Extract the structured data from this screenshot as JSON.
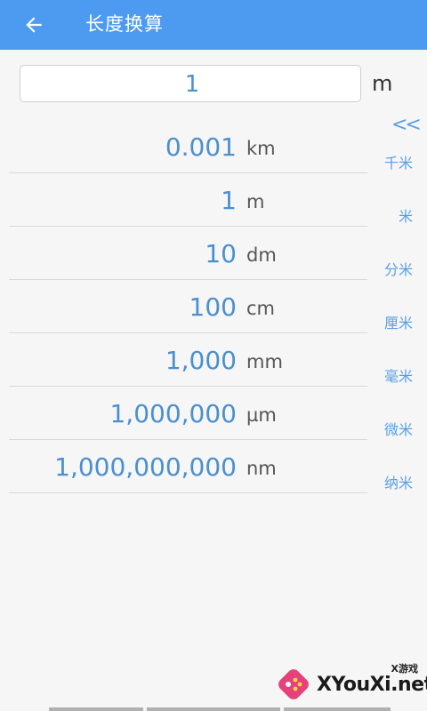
{
  "appbar": {
    "title": "长度换算",
    "back_icon": "arrow-left-icon"
  },
  "input": {
    "value": "1",
    "unit": "m"
  },
  "collapse_label": "<<",
  "rows": [
    {
      "value": "0.001",
      "unit": "km",
      "cn": "千米"
    },
    {
      "value": "1",
      "unit": "m",
      "cn": "米"
    },
    {
      "value": "10",
      "unit": "dm",
      "cn": "分米"
    },
    {
      "value": "100",
      "unit": "cm",
      "cn": "厘米"
    },
    {
      "value": "1,000",
      "unit": "mm",
      "cn": "毫米"
    },
    {
      "value": "1,000,000",
      "unit": "µm",
      "cn": "微米"
    },
    {
      "value": "1,000,000,000",
      "unit": "nm",
      "cn": "纳米"
    }
  ],
  "watermark": {
    "text": "XYouXi.net",
    "sub": "X游戏"
  },
  "colors": {
    "appbar": "#4d9bf0",
    "value_text": "#4a90d0",
    "label_text": "#5aa0e0"
  }
}
